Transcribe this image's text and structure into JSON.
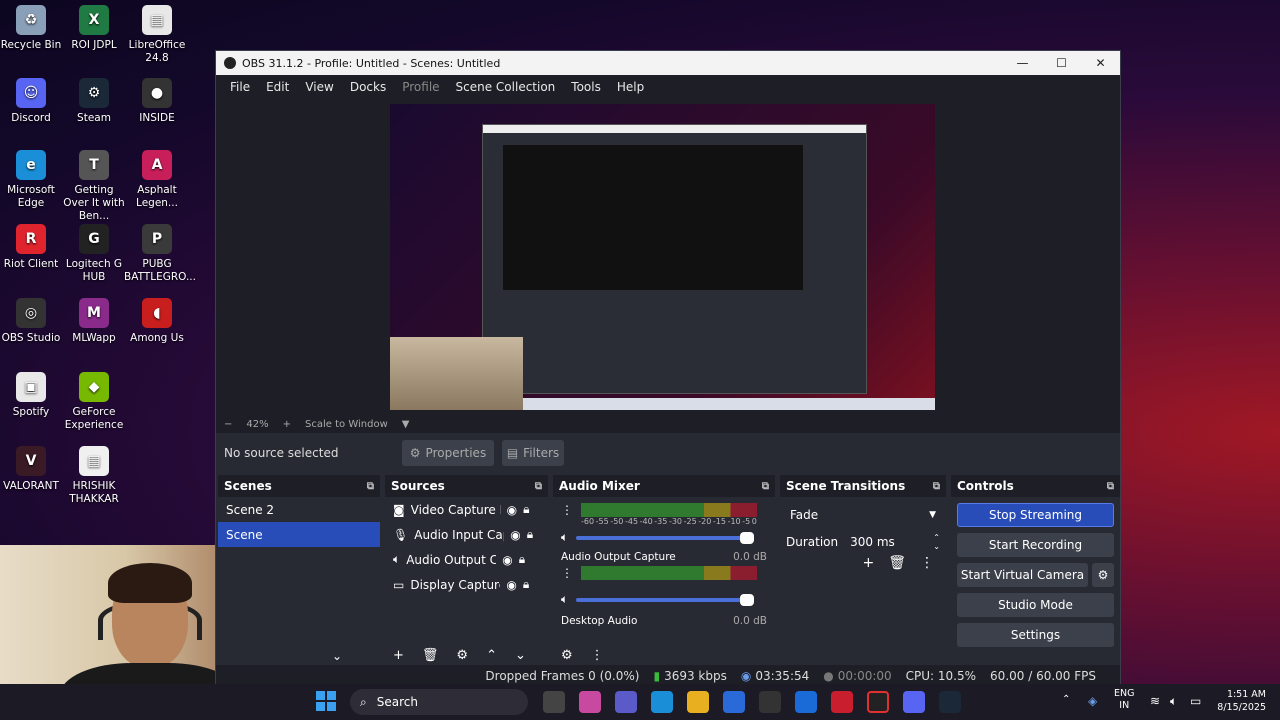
{
  "desktop": [
    {
      "label": "Recycle Bin",
      "color": "#8aa0b8",
      "glyph": "♻"
    },
    {
      "label": "ROI JDPL",
      "color": "#1f7a43",
      "glyph": "X"
    },
    {
      "label": "LibreOffice 24.8",
      "color": "#e8e8e8",
      "glyph": "▤"
    },
    {
      "label": "Discord",
      "color": "#5865f2",
      "glyph": "☺"
    },
    {
      "label": "Steam",
      "color": "#1b2838",
      "glyph": "⚙"
    },
    {
      "label": "INSIDE",
      "color": "#333",
      "glyph": "●"
    },
    {
      "label": "Microsoft Edge",
      "color": "#1a8fd8",
      "glyph": "e"
    },
    {
      "label": "Getting Over It with Ben...",
      "color": "#555",
      "glyph": "T"
    },
    {
      "label": "Asphalt Legen...",
      "color": "#c81e5a",
      "glyph": "A"
    },
    {
      "label": "Riot Client",
      "color": "#e0242e",
      "glyph": "R"
    },
    {
      "label": "Logitech G HUB",
      "color": "#222",
      "glyph": "G"
    },
    {
      "label": "PUBG BATTLEGRO...",
      "color": "#3a3a3a",
      "glyph": "P"
    },
    {
      "label": "OBS Studio",
      "color": "#333",
      "glyph": "◎"
    },
    {
      "label": "MLWapp",
      "color": "#8a2a8a",
      "glyph": "M"
    },
    {
      "label": "Among Us",
      "color": "#c81e1e",
      "glyph": "◖"
    },
    {
      "label": "Spotify",
      "color": "#e8e8e8",
      "glyph": "▣"
    },
    {
      "label": "GeForce Experience",
      "color": "#76b900",
      "glyph": "◆"
    },
    {
      "label": "VALORANT",
      "color": "#3a1a24",
      "glyph": "V"
    },
    {
      "label": "HRISHIK THAKKAR",
      "color": "#f0f0f0",
      "glyph": "▤"
    }
  ],
  "window": {
    "title": "OBS 31.1.2 - Profile: Untitled - Scenes: Untitled",
    "controls": {
      "minimize": "—",
      "maximize": "☐",
      "close": "✕"
    }
  },
  "menu": [
    "File",
    "Edit",
    "View",
    "Docks",
    "Profile",
    "Scene Collection",
    "Tools",
    "Help"
  ],
  "zoom": {
    "minus": "−",
    "percent": "42%",
    "plus": "+",
    "mode": "Scale to Window"
  },
  "source_bar": {
    "no_source": "No source selected",
    "properties": "Properties",
    "filters": "Filters"
  },
  "scenes": {
    "title": "Scenes",
    "items": [
      "Scene 2",
      "Scene"
    ]
  },
  "sources": {
    "title": "Sources",
    "items": [
      "Video Capture De",
      "Audio Input Captu",
      "Audio Output Cap",
      "Display Capture"
    ]
  },
  "mixer": {
    "title": "Audio Mixer",
    "scale": [
      "-60",
      "-55",
      "-50",
      "-45",
      "-40",
      "-35",
      "-30",
      "-25",
      "-20",
      "-15",
      "-10",
      "-5",
      "0"
    ],
    "channels": [
      {
        "name": "Audio Output Capture",
        "db": "0.0 dB"
      },
      {
        "name": "Desktop Audio",
        "db": "0.0 dB"
      }
    ]
  },
  "transitions": {
    "title": "Scene Transitions",
    "selected": "Fade",
    "duration_label": "Duration",
    "duration": "300 ms"
  },
  "controls": {
    "title": "Controls",
    "buttons": [
      "Stop Streaming",
      "Start Recording",
      "Start Virtual Camera",
      "Studio Mode",
      "Settings"
    ]
  },
  "status": {
    "dropped": "Dropped Frames 0 (0.0%)",
    "bitrate": "3693 kbps",
    "stream_time": "03:35:54",
    "rec_time": "00:00:00",
    "cpu": "CPU: 10.5%",
    "fps": "60.00 / 60.00 FPS"
  },
  "taskbar": {
    "search": "Search",
    "lang1": "ENG",
    "lang2": "IN",
    "time": "1:51 AM",
    "date": "8/15/2025"
  }
}
